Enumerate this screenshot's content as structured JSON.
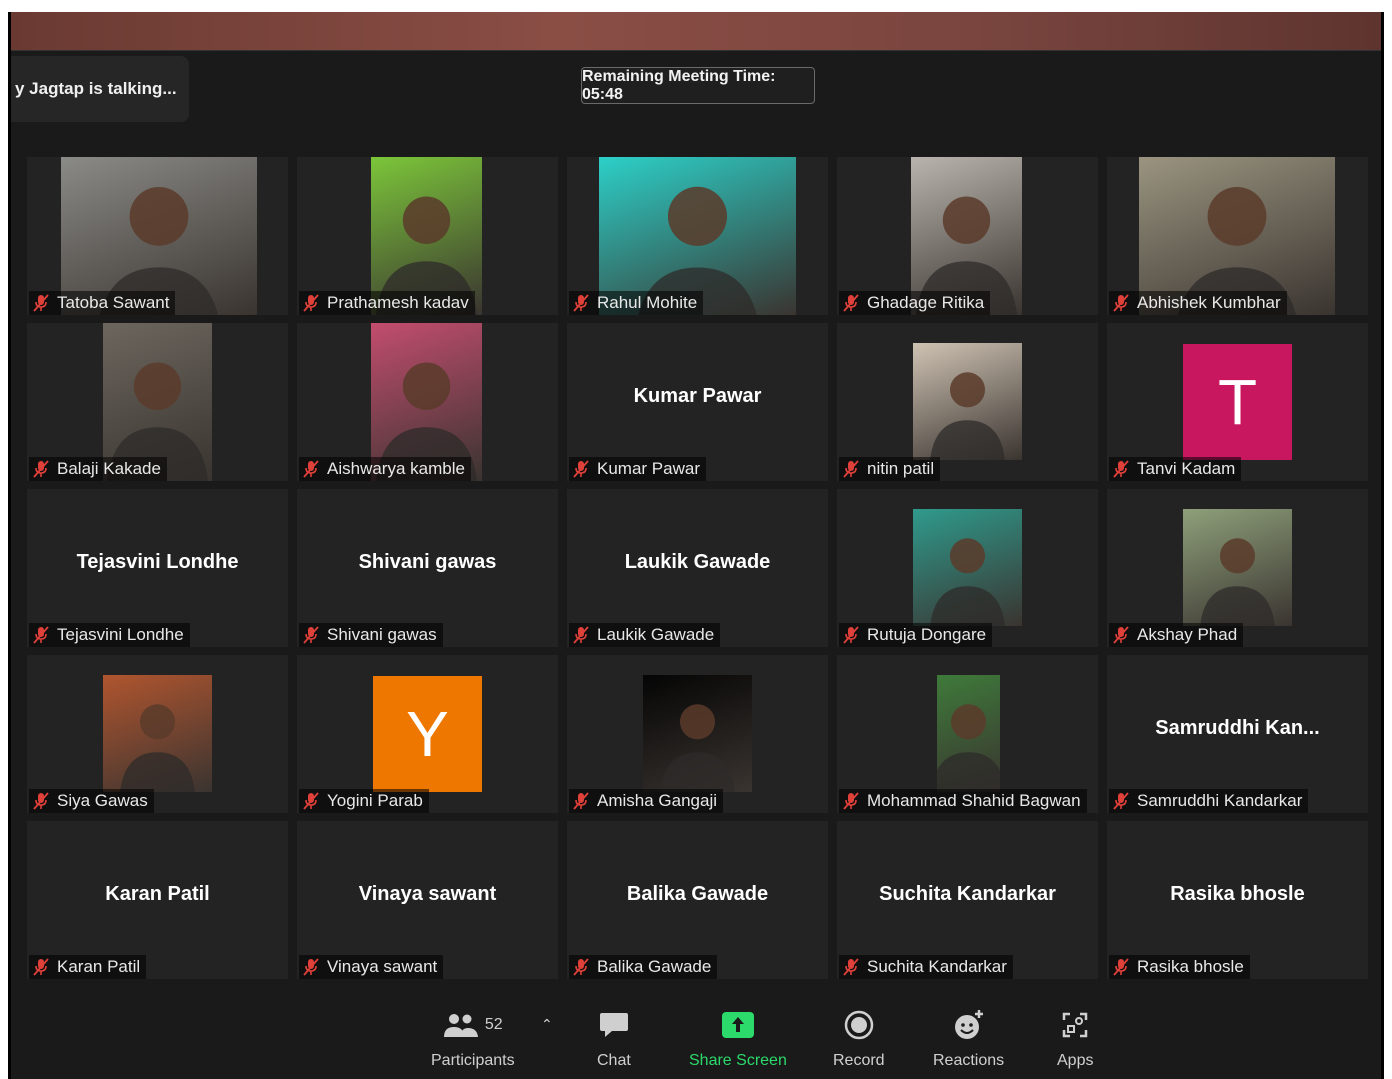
{
  "talking_indicator": "y Jagtap is talking...",
  "remaining_time": "Remaining Meeting Time: 05:48",
  "tiles": [
    {
      "name": "Tatoba Sawant",
      "big": "",
      "kind": "video",
      "color": "#8a8a86"
    },
    {
      "name": "Prathamesh kadav",
      "big": "",
      "kind": "video",
      "color": "#7cc63a"
    },
    {
      "name": "Rahul Mohite",
      "big": "",
      "kind": "video",
      "color": "#2cd0c8"
    },
    {
      "name": "Ghadage Ritika",
      "big": "",
      "kind": "video",
      "color": "#b9b4ad"
    },
    {
      "name": "Abhishek Kumbhar",
      "big": "",
      "kind": "video",
      "color": "#9a9480"
    },
    {
      "name": "Balaji Kakade",
      "big": "",
      "kind": "video",
      "color": "#6c665e"
    },
    {
      "name": "Aishwarya kamble",
      "big": "",
      "kind": "video",
      "color": "#c24d6e"
    },
    {
      "name": "Kumar Pawar",
      "big": "Kumar Pawar",
      "kind": "name",
      "color": ""
    },
    {
      "name": "nitin patil",
      "big": "",
      "kind": "photo",
      "color": "#cfc3b3"
    },
    {
      "name": "Tanvi Kadam",
      "big": "",
      "kind": "letter",
      "letter": "T",
      "color": "#c8175e"
    },
    {
      "name": "Tejasvini Londhe",
      "big": "Tejasvini Londhe",
      "kind": "name",
      "color": ""
    },
    {
      "name": "Shivani gawas",
      "big": "Shivani gawas",
      "kind": "name",
      "color": ""
    },
    {
      "name": "Laukik Gawade",
      "big": "Laukik Gawade",
      "kind": "name",
      "color": ""
    },
    {
      "name": "Rutuja Dongare",
      "big": "",
      "kind": "photo",
      "color": "#2f9a8c"
    },
    {
      "name": "Akshay Phad",
      "big": "",
      "kind": "photo",
      "color": "#8ea07a"
    },
    {
      "name": "Siya Gawas",
      "big": "",
      "kind": "photo",
      "color": "#b0552f"
    },
    {
      "name": "Yogini Parab",
      "big": "",
      "kind": "letter",
      "letter": "Y",
      "color": "#ee7700"
    },
    {
      "name": "Amisha Gangaji",
      "big": "",
      "kind": "photo",
      "color": "#050505"
    },
    {
      "name": "Mohammad Shahid Bagwan",
      "big": "",
      "kind": "photo",
      "color": "#3e7a3a"
    },
    {
      "name": "Samruddhi Kandarkar",
      "big": "Samruddhi  Kan...",
      "kind": "name",
      "color": ""
    },
    {
      "name": "Karan Patil",
      "big": "Karan Patil",
      "kind": "name",
      "color": ""
    },
    {
      "name": "Vinaya sawant",
      "big": "Vinaya sawant",
      "kind": "name",
      "color": ""
    },
    {
      "name": "Balika Gawade",
      "big": "Balika Gawade",
      "kind": "name",
      "color": ""
    },
    {
      "name": "Suchita Kandarkar",
      "big": "Suchita Kandarkar",
      "kind": "name",
      "color": ""
    },
    {
      "name": "Rasika bhosle",
      "big": "Rasika bhosle",
      "kind": "name",
      "color": ""
    }
  ],
  "toolbar": {
    "participants_label": "Participants",
    "participants_count": "52",
    "chat_label": "Chat",
    "share_label": "Share Screen",
    "record_label": "Record",
    "reactions_label": "Reactions",
    "apps_label": "Apps"
  },
  "colors": {
    "mic_muted": "#e0403a",
    "share_green": "#2cd96b"
  },
  "icons": [
    "muted-mic-icon",
    "participants-icon",
    "chevron-up-icon",
    "chat-icon",
    "share-screen-icon",
    "record-icon",
    "reactions-icon",
    "apps-icon"
  ]
}
